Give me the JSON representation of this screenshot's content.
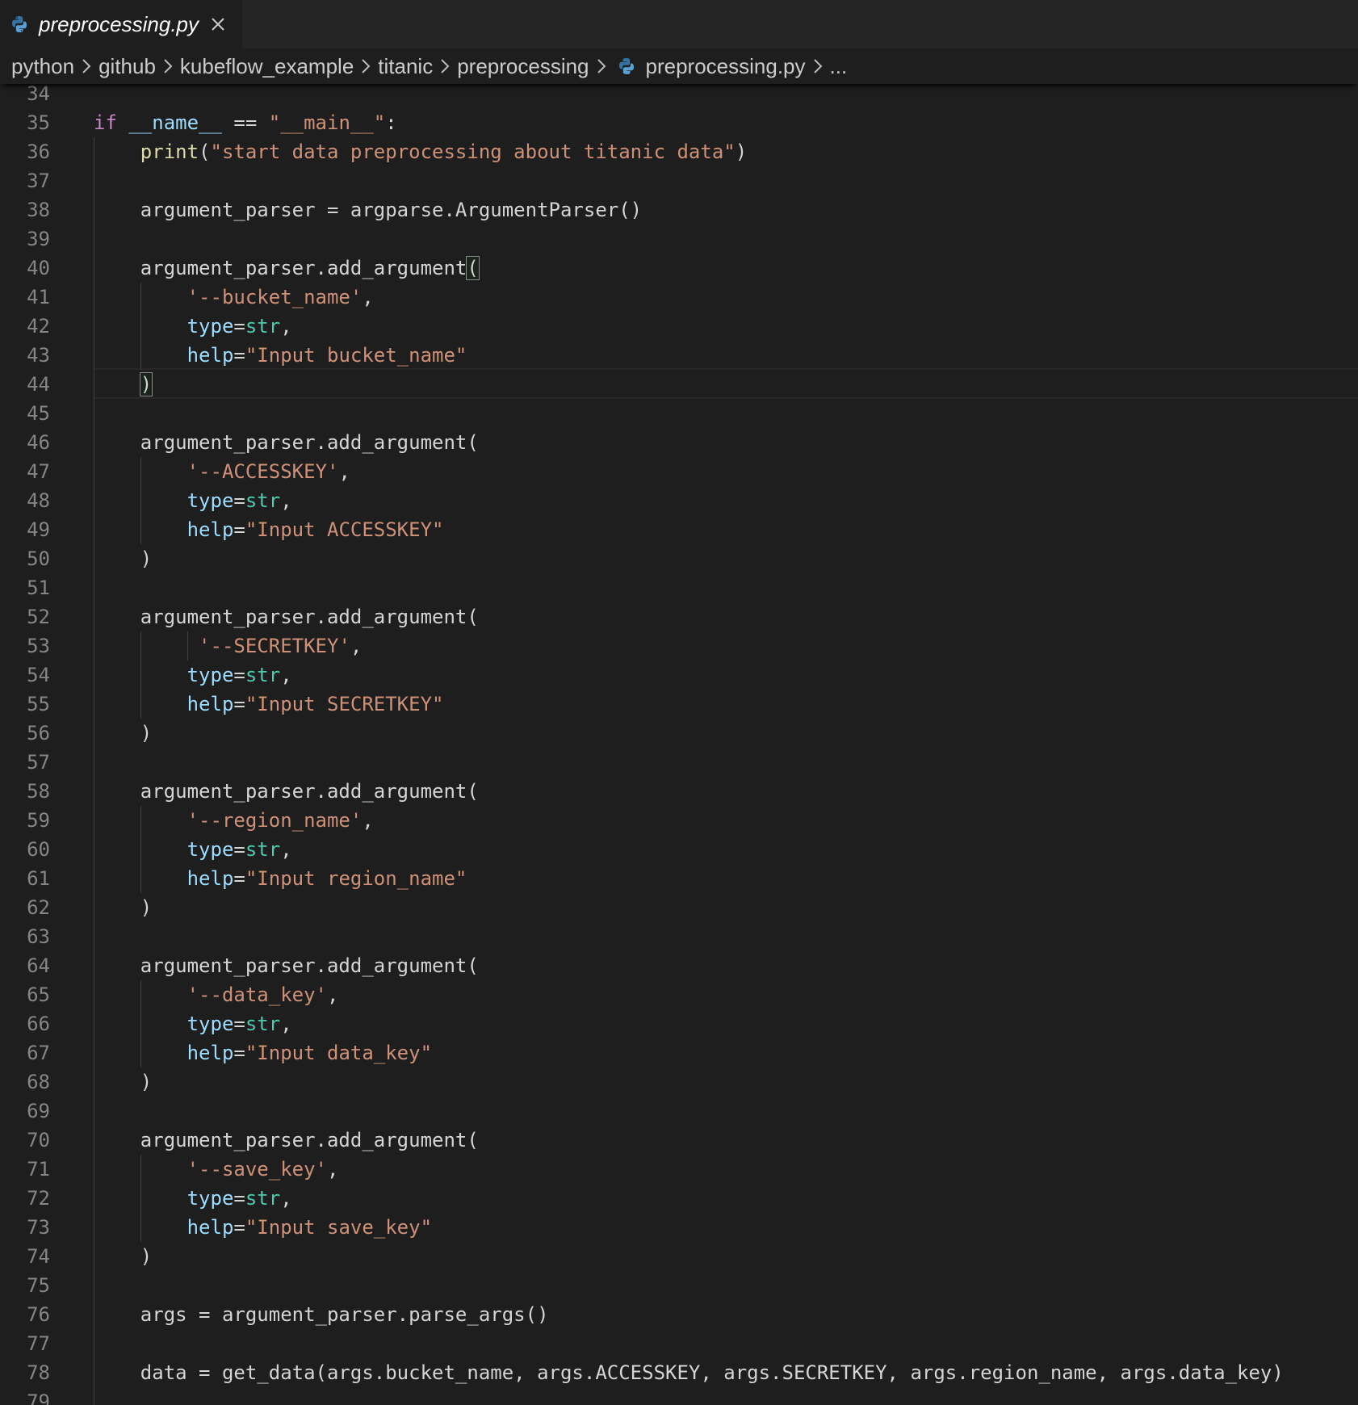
{
  "tab": {
    "filename": "preprocessing.py",
    "icon": "python-icon",
    "close_icon": "close-icon"
  },
  "breadcrumb": {
    "items": [
      "python",
      "github",
      "kubeflow_example",
      "titanic",
      "preprocessing",
      "preprocessing.py",
      "..."
    ]
  },
  "colors": {
    "background": "#1e1e1e",
    "keyword": "#c586c0",
    "function": "#dcdcaa",
    "string": "#ce9178",
    "parameter": "#9cdcfe",
    "type": "#4ec9b0",
    "line_number": "#858585"
  },
  "editor": {
    "lines": [
      {
        "n": "34",
        "tokens": []
      },
      {
        "n": "35",
        "tokens": [
          [
            "kw",
            "if"
          ],
          [
            "plain",
            " "
          ],
          [
            "var",
            "__name__"
          ],
          [
            "plain",
            " == "
          ],
          [
            "str",
            "\"__main__\""
          ],
          [
            "plain",
            ":"
          ]
        ]
      },
      {
        "n": "36",
        "tokens": [
          [
            "plain",
            "    "
          ],
          [
            "fn",
            "print"
          ],
          [
            "plain",
            "("
          ],
          [
            "str",
            "\"start data preprocessing about titanic data\""
          ],
          [
            "plain",
            ")"
          ]
        ]
      },
      {
        "n": "37",
        "tokens": []
      },
      {
        "n": "38",
        "tokens": [
          [
            "plain",
            "    argument_parser = argparse.ArgumentParser()"
          ]
        ]
      },
      {
        "n": "39",
        "tokens": []
      },
      {
        "n": "40",
        "tokens": [
          [
            "plain",
            "    argument_parser.add_argument"
          ],
          [
            "bracket",
            "("
          ]
        ]
      },
      {
        "n": "41",
        "tokens": [
          [
            "plain",
            "        "
          ],
          [
            "str",
            "'--bucket_name'"
          ],
          [
            "plain",
            ","
          ]
        ]
      },
      {
        "n": "42",
        "tokens": [
          [
            "plain",
            "        "
          ],
          [
            "param",
            "type"
          ],
          [
            "plain",
            "="
          ],
          [
            "typ",
            "str"
          ],
          [
            "plain",
            ","
          ]
        ]
      },
      {
        "n": "43",
        "tokens": [
          [
            "plain",
            "        "
          ],
          [
            "param",
            "help"
          ],
          [
            "plain",
            "="
          ],
          [
            "str",
            "\"Input bucket_name\""
          ]
        ]
      },
      {
        "n": "44",
        "tokens": [
          [
            "plain",
            "    "
          ],
          [
            "bracket",
            ")"
          ]
        ]
      },
      {
        "n": "45",
        "tokens": []
      },
      {
        "n": "46",
        "tokens": [
          [
            "plain",
            "    argument_parser.add_argument("
          ]
        ]
      },
      {
        "n": "47",
        "tokens": [
          [
            "plain",
            "        "
          ],
          [
            "str",
            "'--ACCESSKEY'"
          ],
          [
            "plain",
            ","
          ]
        ]
      },
      {
        "n": "48",
        "tokens": [
          [
            "plain",
            "        "
          ],
          [
            "param",
            "type"
          ],
          [
            "plain",
            "="
          ],
          [
            "typ",
            "str"
          ],
          [
            "plain",
            ","
          ]
        ]
      },
      {
        "n": "49",
        "tokens": [
          [
            "plain",
            "        "
          ],
          [
            "param",
            "help"
          ],
          [
            "plain",
            "="
          ],
          [
            "str",
            "\"Input ACCESSKEY\""
          ]
        ]
      },
      {
        "n": "50",
        "tokens": [
          [
            "plain",
            "    )"
          ]
        ]
      },
      {
        "n": "51",
        "tokens": []
      },
      {
        "n": "52",
        "tokens": [
          [
            "plain",
            "    argument_parser.add_argument("
          ]
        ]
      },
      {
        "n": "53",
        "tokens": [
          [
            "plain",
            "         "
          ],
          [
            "str",
            "'--SECRETKEY'"
          ],
          [
            "plain",
            ","
          ]
        ]
      },
      {
        "n": "54",
        "tokens": [
          [
            "plain",
            "        "
          ],
          [
            "param",
            "type"
          ],
          [
            "plain",
            "="
          ],
          [
            "typ",
            "str"
          ],
          [
            "plain",
            ","
          ]
        ]
      },
      {
        "n": "55",
        "tokens": [
          [
            "plain",
            "        "
          ],
          [
            "param",
            "help"
          ],
          [
            "plain",
            "="
          ],
          [
            "str",
            "\"Input SECRETKEY\""
          ]
        ]
      },
      {
        "n": "56",
        "tokens": [
          [
            "plain",
            "    )"
          ]
        ]
      },
      {
        "n": "57",
        "tokens": []
      },
      {
        "n": "58",
        "tokens": [
          [
            "plain",
            "    argument_parser.add_argument("
          ]
        ]
      },
      {
        "n": "59",
        "tokens": [
          [
            "plain",
            "        "
          ],
          [
            "str",
            "'--region_name'"
          ],
          [
            "plain",
            ","
          ]
        ]
      },
      {
        "n": "60",
        "tokens": [
          [
            "plain",
            "        "
          ],
          [
            "param",
            "type"
          ],
          [
            "plain",
            "="
          ],
          [
            "typ",
            "str"
          ],
          [
            "plain",
            ","
          ]
        ]
      },
      {
        "n": "61",
        "tokens": [
          [
            "plain",
            "        "
          ],
          [
            "param",
            "help"
          ],
          [
            "plain",
            "="
          ],
          [
            "str",
            "\"Input region_name\""
          ]
        ]
      },
      {
        "n": "62",
        "tokens": [
          [
            "plain",
            "    )"
          ]
        ]
      },
      {
        "n": "63",
        "tokens": []
      },
      {
        "n": "64",
        "tokens": [
          [
            "plain",
            "    argument_parser.add_argument("
          ]
        ]
      },
      {
        "n": "65",
        "tokens": [
          [
            "plain",
            "        "
          ],
          [
            "str",
            "'--data_key'"
          ],
          [
            "plain",
            ","
          ]
        ]
      },
      {
        "n": "66",
        "tokens": [
          [
            "plain",
            "        "
          ],
          [
            "param",
            "type"
          ],
          [
            "plain",
            "="
          ],
          [
            "typ",
            "str"
          ],
          [
            "plain",
            ","
          ]
        ]
      },
      {
        "n": "67",
        "tokens": [
          [
            "plain",
            "        "
          ],
          [
            "param",
            "help"
          ],
          [
            "plain",
            "="
          ],
          [
            "str",
            "\"Input data_key\""
          ]
        ]
      },
      {
        "n": "68",
        "tokens": [
          [
            "plain",
            "    )"
          ]
        ]
      },
      {
        "n": "69",
        "tokens": []
      },
      {
        "n": "70",
        "tokens": [
          [
            "plain",
            "    argument_parser.add_argument("
          ]
        ]
      },
      {
        "n": "71",
        "tokens": [
          [
            "plain",
            "        "
          ],
          [
            "str",
            "'--save_key'"
          ],
          [
            "plain",
            ","
          ]
        ]
      },
      {
        "n": "72",
        "tokens": [
          [
            "plain",
            "        "
          ],
          [
            "param",
            "type"
          ],
          [
            "plain",
            "="
          ],
          [
            "typ",
            "str"
          ],
          [
            "plain",
            ","
          ]
        ]
      },
      {
        "n": "73",
        "tokens": [
          [
            "plain",
            "        "
          ],
          [
            "param",
            "help"
          ],
          [
            "plain",
            "="
          ],
          [
            "str",
            "\"Input save_key\""
          ]
        ]
      },
      {
        "n": "74",
        "tokens": [
          [
            "plain",
            "    )"
          ]
        ]
      },
      {
        "n": "75",
        "tokens": []
      },
      {
        "n": "76",
        "tokens": [
          [
            "plain",
            "    args = argument_parser.parse_args()"
          ]
        ]
      },
      {
        "n": "77",
        "tokens": []
      },
      {
        "n": "78",
        "tokens": [
          [
            "plain",
            "    data = get_data(args.bucket_name, args.ACCESSKEY, args.SECRETKEY, args.region_name, args.data_key)"
          ]
        ]
      },
      {
        "n": "79",
        "tokens": []
      }
    ],
    "current_line": "44"
  }
}
